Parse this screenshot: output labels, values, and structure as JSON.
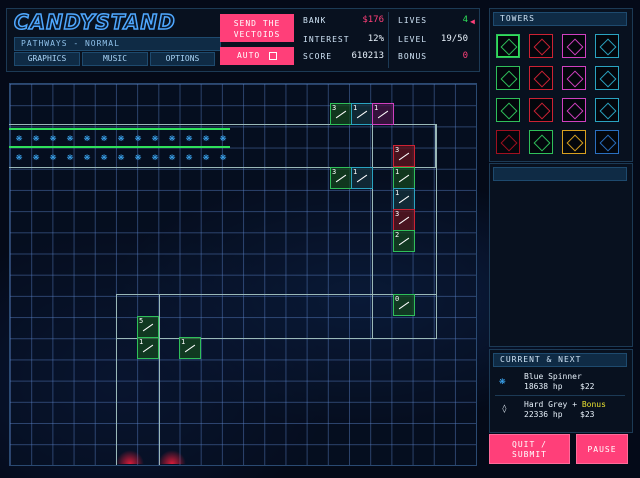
{
  "header": {
    "logo": "CANDYSTAND",
    "pathways": "PATHWAYS - NORMAL",
    "graphics_label": "GRAPHICS",
    "music_label": "MUSIC",
    "options_label": "OPTIONS",
    "send_label": "SEND THE VECTOIDS",
    "auto_label": "AUTO",
    "stats": {
      "bank_label": "BANK",
      "bank_value": "$176",
      "lives_label": "LIVES",
      "lives_value": "4",
      "interest_label": "INTEREST",
      "interest_value": "12%",
      "level_label": "LEVEL",
      "level_value": "19/50",
      "score_label": "SCORE",
      "score_value": "610213",
      "bonus_label": "BONUS",
      "bonus_value": "0"
    }
  },
  "towers_panel": {
    "title": "TOWERS",
    "towers": [
      {
        "name": "green-laser",
        "color": "#2fbf5a"
      },
      {
        "name": "red-splash",
        "color": "#cc2233"
      },
      {
        "name": "magenta-beam",
        "color": "#d040c0"
      },
      {
        "name": "cyan-disc",
        "color": "#2aa3c0"
      },
      {
        "name": "green-dart",
        "color": "#2fbf5a"
      },
      {
        "name": "red-dart",
        "color": "#cc2233"
      },
      {
        "name": "magenta-dart",
        "color": "#d040c0"
      },
      {
        "name": "cyan-grid",
        "color": "#2aa3c0"
      },
      {
        "name": "green-shot",
        "color": "#2fbf5a"
      },
      {
        "name": "red-box",
        "color": "#cc2233"
      },
      {
        "name": "magenta-bars",
        "color": "#d040c0"
      },
      {
        "name": "cyan-orb",
        "color": "#2aa3c0"
      },
      {
        "name": "red-blob",
        "color": "#a01020"
      },
      {
        "name": "green-star",
        "color": "#2fbf5a"
      },
      {
        "name": "gold-dollar",
        "color": "#d8a020"
      },
      {
        "name": "cyan-splat",
        "color": "#2a6fc0"
      }
    ]
  },
  "current_next": {
    "title": "CURRENT & NEXT",
    "current_name": "Blue Spinner",
    "current_hp": "18638 hp",
    "current_reward": "$22",
    "next_name": "Hard Grey",
    "next_plus": "+",
    "next_bonus": "Bonus",
    "next_hp": "22336 hp",
    "next_reward": "$23"
  },
  "buttons": {
    "quit_line1": "QUIT /",
    "quit_line2": "SUBMIT",
    "pause_label": "PAUSE"
  },
  "board": {
    "placed_towers": [
      {
        "label": "3",
        "kind": "green"
      },
      {
        "label": "1",
        "kind": "cyan"
      },
      {
        "label": "1",
        "kind": "magenta"
      },
      {
        "label": "3",
        "kind": "green"
      },
      {
        "label": "1",
        "kind": "cyan"
      },
      {
        "label": "3",
        "kind": "red"
      },
      {
        "label": "1",
        "kind": "green"
      },
      {
        "label": "1",
        "kind": "cyan"
      },
      {
        "label": "3",
        "kind": "red"
      },
      {
        "label": "2",
        "kind": "green"
      },
      {
        "label": "0",
        "kind": "green"
      },
      {
        "label": "5",
        "kind": "green"
      },
      {
        "label": "1",
        "kind": "green"
      },
      {
        "label": "1",
        "kind": "green"
      }
    ]
  }
}
